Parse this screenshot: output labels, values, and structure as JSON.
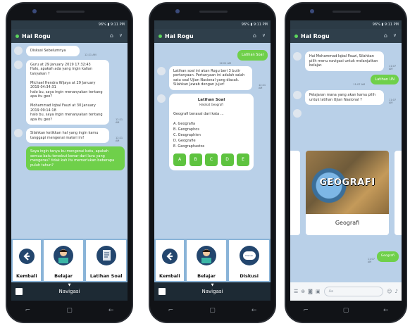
{
  "status_text": "96% ▮ 9:11 PM",
  "screen1": {
    "title": "Hai Rogu",
    "messages": [
      {
        "text": "Diskusi Sebelumnya",
        "time": "12:21 AM"
      },
      {
        "text": "Guru at 29 January 2019 17:32:43\nHalo, apakah ada yang ingin kalian tanyakan ?\n\nMichael Hendra Wijaya at 29 January 2019 04:34:31\nhalo bu, saya ingin menanyakan tentang apa itu geo?\n\nMohammad Iqbal Fauzi at 30 January 2019 09:14:18\nhalo bu, saya ingin menanyakan tentang apa itu geo?",
        "time": "12:21 AM"
      },
      {
        "text": "Silahkan ketikkan hal yang ingin kamu tanggapi mengenai materi ini!",
        "time": "12:21 AM"
      },
      {
        "text": "Saya ingin tanya bu mengenai batu, apakah semua batu tersebut benar dari lava yang mengeras? tidak kah itu memerlukan beberapa puluh tahun?"
      }
    ],
    "nav_buttons": [
      "Kembali",
      "Belajar",
      "Latihan Soal"
    ],
    "nav_label": "Navigasi"
  },
  "screen2": {
    "title": "Hai Rogu",
    "user_msg": "Latihan Soal",
    "user_time": "12:21 AM",
    "bot_msg": "Latihan soal ini akan Rogu beri 3 butir pertanyaan. Pertanyaan ini adalah salah satu soal Ujian Nasional yang diacak. Silahkan Jawab dengan jujur!",
    "bot_time": "12:21 AM",
    "quiz_title": "Latihan Soal",
    "quiz_sub": "Hakikat Geografi",
    "question": "Geografi berasal dari kata ...",
    "answers": [
      "A. Geografia",
      "B. Geographos",
      "C. Geographien",
      "D. Geografie",
      "E. Geographastos"
    ],
    "options": [
      "A",
      "B",
      "C",
      "D",
      "E"
    ],
    "nav_buttons": [
      "Kembali",
      "Belajar",
      "Diskusi"
    ],
    "discuss_icon_text": "Diskusi",
    "nav_label": "Navigasi"
  },
  "screen3": {
    "title": "Hai Rogu",
    "bot_msg1": "Hai Mohammad Iqbal Fauzi, Silahkan pilih menu navigasi untuk melanjutkan belajar.",
    "bot_time1": "11:07 AM",
    "user_msg": "Latihan UN",
    "user_time": "11:07 AM",
    "bot_msg2": "Pelajaran mana yang akan kamu pilih untuk latihan Ujian Nasional ?",
    "bot_time2": "11:07 AM",
    "card_image_text": "GEOGRAFI",
    "card_label": "Geografi",
    "user_msg2": "Geografi",
    "user_time2": "11:07 AM"
  }
}
